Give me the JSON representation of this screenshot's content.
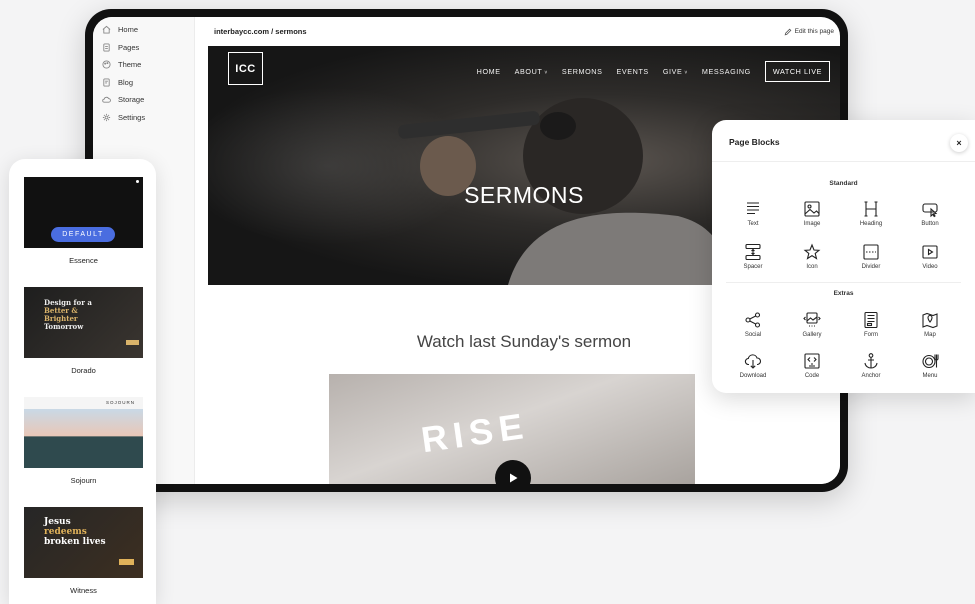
{
  "sidebar": {
    "items": [
      {
        "label": "Home",
        "icon": "home-icon"
      },
      {
        "label": "Pages",
        "icon": "pages-icon"
      },
      {
        "label": "Theme",
        "icon": "palette-icon"
      },
      {
        "label": "Blog",
        "icon": "blog-icon"
      },
      {
        "label": "Storage",
        "icon": "cloud-icon"
      },
      {
        "label": "Settings",
        "icon": "gear-icon"
      }
    ]
  },
  "urlbar": {
    "url": "interbaycc.com / sermons",
    "edit_label": "Edit this page"
  },
  "site": {
    "logo": "ICC",
    "nav": {
      "home": "HOME",
      "about": "ABOUT",
      "sermons": "SERMONS",
      "events": "EVENTS",
      "give": "GIVE",
      "messaging": "MESSAGING",
      "watch_live": "WATCH LIVE"
    },
    "hero_title": "SERMONS",
    "section_title": "Watch last Sunday's sermon",
    "video_text": "RISE"
  },
  "themes": {
    "essence": {
      "name": "Essence",
      "button": "DEFAULT"
    },
    "dorado": {
      "name": "Dorado",
      "l1": "Design for a",
      "l2": "Better &",
      "l3": "Brighter",
      "l4": "Tomorrow"
    },
    "sojourn": {
      "name": "Sojourn",
      "logo": "SOJOURN"
    },
    "witness": {
      "name": "Witness",
      "l1": "Jesus",
      "l2": "redeems",
      "l3": "broken lives"
    }
  },
  "panel": {
    "title": "Page Blocks",
    "standard_label": "Standard",
    "extras_label": "Extras",
    "standard": [
      "Text",
      "Image",
      "Heading",
      "Button",
      "Spacer",
      "Icon",
      "Divider",
      "Video"
    ],
    "extras": [
      "Social",
      "Gallery",
      "Form",
      "Map",
      "Download",
      "Code",
      "Anchor",
      "Menu"
    ]
  },
  "colors": {
    "accent": "#4a6de0",
    "device": "#111111",
    "background": "#f4f4f5"
  }
}
